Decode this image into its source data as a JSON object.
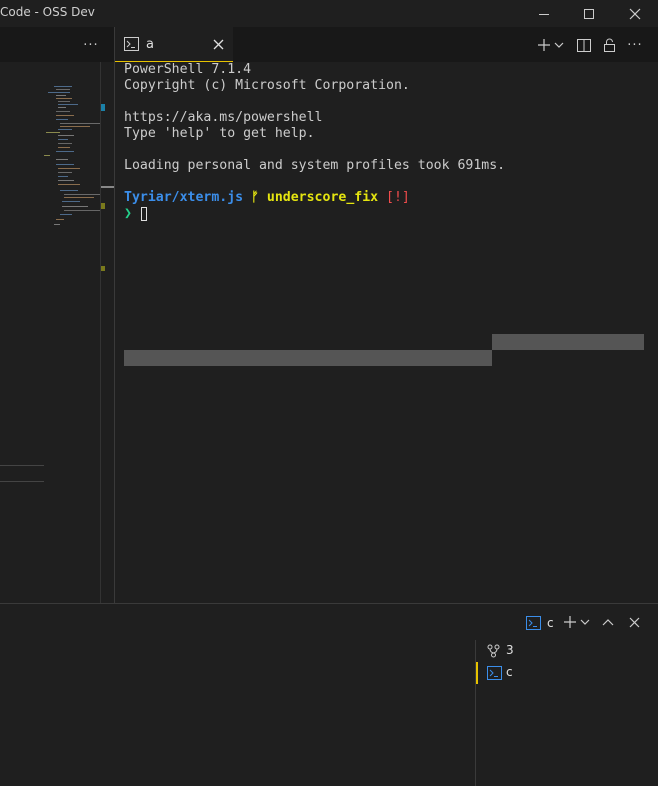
{
  "window": {
    "title": "Code - OSS Dev",
    "controls": [
      "minimize",
      "maximize",
      "close"
    ]
  },
  "left_group": {
    "more_actions_label": "···"
  },
  "terminal_editor": {
    "tab": {
      "label": "a",
      "icon": "terminal-icon",
      "close": "close-icon"
    },
    "actions": [
      "new-terminal",
      "dropdown",
      "split-editor",
      "lock",
      "more"
    ],
    "more_label": "···",
    "lines": [
      "PowerShell 7.1.4",
      "Copyright (c) Microsoft Corporation.",
      "",
      "https://aka.ms/powershell",
      "Type 'help' to get help.",
      "",
      "Loading personal and system profiles took 691ms."
    ],
    "prompt": {
      "path": "Tyriar/xterm.js",
      "branch_icon": "ᚠ",
      "branch": "underscore_fix",
      "status": "[!]",
      "caret": "❯"
    },
    "colors": {
      "path": "#3b8eea",
      "branch": "#e5e510",
      "status": "#f14c4c",
      "caret": "#23d18b",
      "selection": "#555555",
      "accent": "#e6c200"
    }
  },
  "panel": {
    "header_terminal_label": "c",
    "terminal_list": [
      {
        "icon": "git-merge-icon",
        "label": "3"
      },
      {
        "icon": "terminal-icon",
        "label": "c",
        "active": true
      }
    ]
  }
}
